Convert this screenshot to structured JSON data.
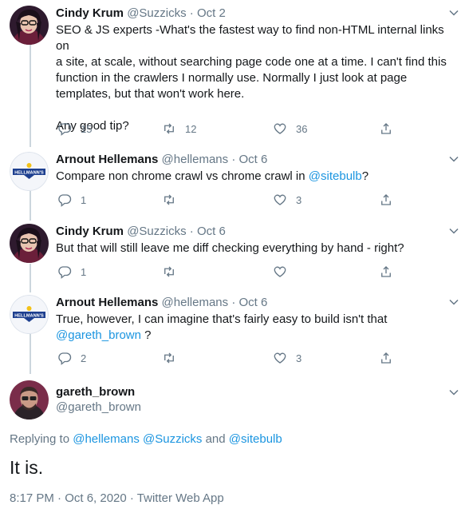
{
  "tweets": [
    {
      "name": "Cindy Krum",
      "handle": "@Suzzicks",
      "sep": "·",
      "date": "Oct 2",
      "lines": [
        "SEO & JS experts -What's the fastest way to find non-HTML internal links on",
        "a site, at scale, without searching page code one at a time. I can't find this",
        "function in the crawlers I normally use. Normally I just look at page",
        "templates, but that won't work here.",
        "",
        "Any good tip?"
      ],
      "replies": "15",
      "retweets": "12",
      "likes": "36"
    },
    {
      "name": "Arnout Hellemans",
      "handle": "@hellemans",
      "sep": "·",
      "date": "Oct 6",
      "text_before": "Compare non chrome crawl vs chrome crawl in ",
      "mention": "@sitebulb",
      "text_after": "?",
      "avatar_text": "HELLMANN'S",
      "replies": "1",
      "retweets": "",
      "likes": "3"
    },
    {
      "name": "Cindy Krum",
      "handle": "@Suzzicks",
      "sep": "·",
      "date": "Oct 6",
      "text": "But that will still leave me diff checking everything by hand - right?",
      "replies": "1",
      "retweets": "",
      "likes": ""
    },
    {
      "name": "Arnout Hellemans",
      "handle": "@hellemans",
      "sep": "·",
      "date": "Oct 6",
      "text_line1": "True, however, I can imagine that's fairly easy to build isn't that",
      "mention": "@gareth_brown",
      "text_after": " ?",
      "avatar_text": "HELLMANN'S",
      "replies": "2",
      "retweets": "",
      "likes": "3"
    }
  ],
  "main": {
    "name": "gareth_brown",
    "handle": "@gareth_brown",
    "replying_prefix": "Replying to ",
    "replying_to": [
      "@hellemans",
      "@Suzzicks",
      "@sitebulb"
    ],
    "replying_and": " and ",
    "text": "It is.",
    "footer": "8:17 PM · Oct 6, 2020 · Twitter Web App"
  },
  "colors": {
    "text": "#14171a",
    "muted": "#657786",
    "link": "#1b95e0",
    "line": "#ccd6dd"
  },
  "icons": [
    "reply-icon",
    "retweet-icon",
    "like-icon",
    "share-icon",
    "chevron-down-icon"
  ]
}
